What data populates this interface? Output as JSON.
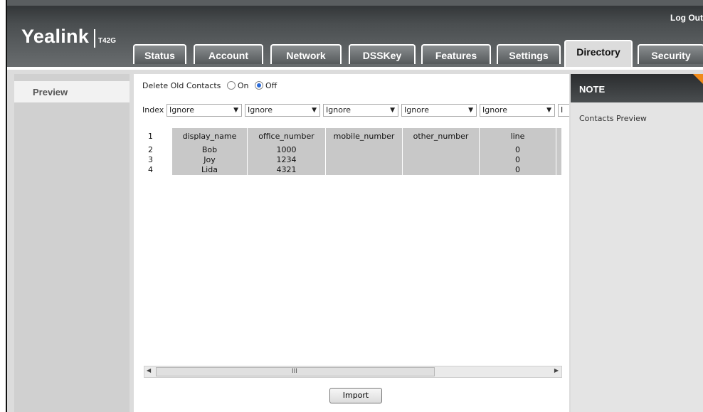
{
  "header": {
    "logo": "Yealink",
    "model": "T42G",
    "logout_label": "Log Out",
    "tabs": [
      {
        "label": "Status"
      },
      {
        "label": "Account"
      },
      {
        "label": "Network"
      },
      {
        "label": "DSSKey"
      },
      {
        "label": "Features"
      },
      {
        "label": "Settings"
      },
      {
        "label": "Directory"
      },
      {
        "label": "Security"
      }
    ],
    "active_tab": "Directory"
  },
  "sidebar": {
    "items": [
      {
        "label": "Preview"
      }
    ]
  },
  "main": {
    "delete_old_contacts": {
      "label": "Delete Old Contacts",
      "on_label": "On",
      "off_label": "Off",
      "selected": "Off"
    },
    "index_label": "Index",
    "column_selects": [
      "Ignore",
      "Ignore",
      "Ignore",
      "Ignore",
      "Ignore",
      "I"
    ],
    "table": {
      "rows": [
        {
          "index": "1",
          "cells": [
            "display_name",
            "office_number",
            "mobile_number",
            "other_number",
            "line"
          ]
        },
        {
          "index": "2",
          "cells": [
            "Bob",
            "1000",
            "",
            "",
            "0"
          ]
        },
        {
          "index": "3",
          "cells": [
            "Joy",
            "1234",
            "",
            "",
            "0"
          ]
        },
        {
          "index": "4",
          "cells": [
            "Lida",
            "4321",
            "",
            "",
            "0"
          ]
        }
      ]
    },
    "scrollbar_grip": "III",
    "import_label": "Import"
  },
  "note": {
    "title": "NOTE",
    "text": "Contacts Preview"
  },
  "colors": {
    "header_dark": "#2c2f31",
    "note_corner": "#f08a1a",
    "radio_selected": "#2a6ad8"
  }
}
